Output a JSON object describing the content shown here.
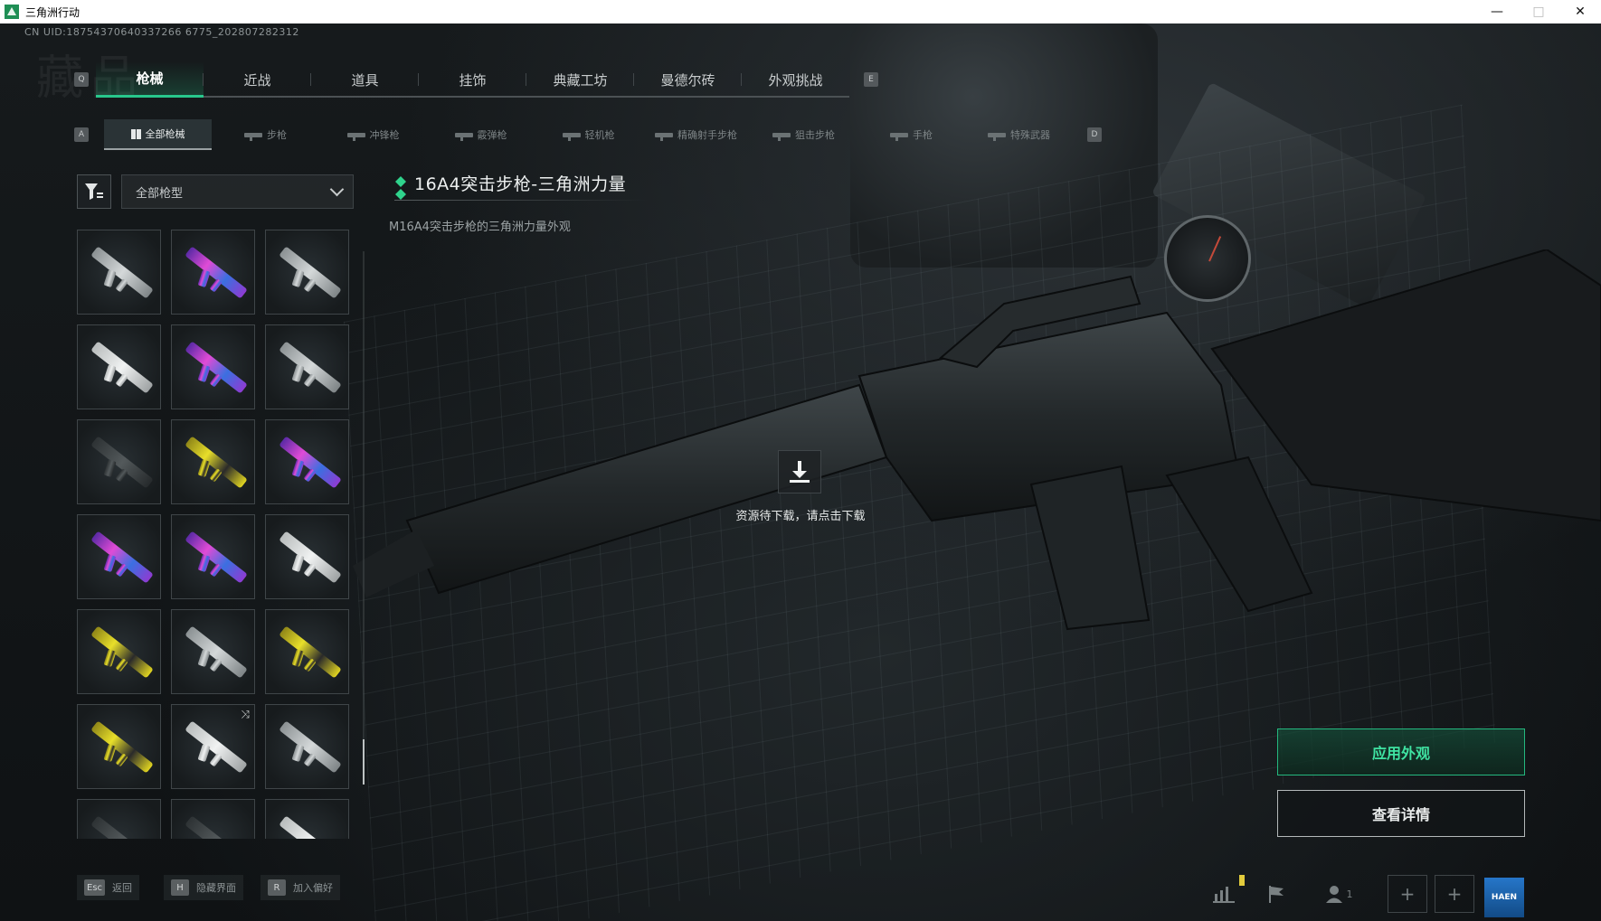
{
  "window": {
    "title": "三角洲行动",
    "controls": [
      "minimize",
      "maximize",
      "close"
    ]
  },
  "uid": "CN UID:18754370640337266 6775_202807282312",
  "main_tabs": {
    "left_key": "Q",
    "right_key": "E",
    "items": [
      {
        "label": "枪械",
        "active": true
      },
      {
        "label": "近战"
      },
      {
        "label": "道具"
      },
      {
        "label": "挂饰"
      },
      {
        "label": "典藏工坊"
      },
      {
        "label": "曼德尔砖"
      },
      {
        "label": "外观挑战"
      }
    ]
  },
  "sub_tabs": {
    "left_key": "A",
    "right_key": "D",
    "items": [
      {
        "label": "全部枪械",
        "active": true
      },
      {
        "label": "步枪"
      },
      {
        "label": "冲锋枪"
      },
      {
        "label": "霰弹枪"
      },
      {
        "label": "轻机枪"
      },
      {
        "label": "精确射手步枪"
      },
      {
        "label": "狙击步枪"
      },
      {
        "label": "手枪"
      },
      {
        "label": "特殊武器"
      }
    ]
  },
  "filter": {
    "icon": "filter-icon",
    "dropdown_value": "全部枪型"
  },
  "skins": [
    "gray",
    "purple",
    "gray",
    "white",
    "purple",
    "gray",
    "dark",
    "gold",
    "purple",
    "purple",
    "purple",
    "white",
    "gold",
    "gray",
    "gold",
    "gold",
    "white",
    "gray",
    "dark",
    "dark",
    "white"
  ],
  "item": {
    "title": "16A4突击步枪-三角洲力量",
    "description": "M16A4突击步枪的三角洲力量外观",
    "rarity_color": "#2fd38c"
  },
  "download": {
    "icon": "download-icon",
    "text": "资源待下载，请点击下载"
  },
  "actions": {
    "apply": "应用外观",
    "details": "查看详情"
  },
  "bottom_hints": [
    {
      "key": "Esc",
      "label": "返回"
    },
    {
      "key": "H",
      "label": "隐藏界面"
    },
    {
      "key": "R",
      "label": "加入偏好"
    }
  ],
  "hud": {
    "player_count": "1",
    "logo_text": "HAEN"
  },
  "colors": {
    "accent": "#28c78c",
    "background": "#0e1113"
  }
}
